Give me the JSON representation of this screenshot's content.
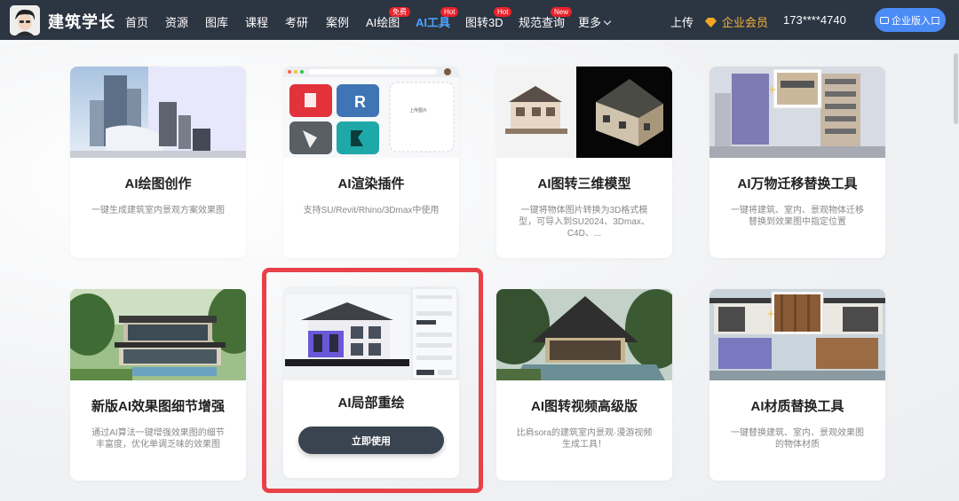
{
  "brand": "建筑学长",
  "nav": {
    "items": [
      {
        "label": "首页"
      },
      {
        "label": "资源"
      },
      {
        "label": "图库"
      },
      {
        "label": "课程"
      },
      {
        "label": "考研"
      },
      {
        "label": "案例"
      },
      {
        "label": "AI绘图",
        "badge": "免费"
      },
      {
        "label": "AI工具",
        "badge": "Hot",
        "active": true
      },
      {
        "label": "图转3D",
        "badge": "Hot"
      },
      {
        "label": "规范查询",
        "badge": "New"
      },
      {
        "label": "更多"
      }
    ],
    "upload": "上传",
    "vip": "企业会员",
    "phone": "173****4740",
    "enterprise": "企业版入口"
  },
  "colors": {
    "accent": "#4da3ff",
    "highlight": "#e8414a",
    "badge": "#e8222b",
    "topbar": "#2c3542"
  },
  "cards": [
    {
      "title": "AI绘图创作",
      "desc": "一键生成建筑室内景观方案效果图"
    },
    {
      "title": "AI渲染插件",
      "desc": "支持SU/Revit/Rhino/3Dmax中使用",
      "thumb_text": "上传图片"
    },
    {
      "title": "AI图转三维模型",
      "desc": "一键将物体图片转换为3D格式模型，可导入到SU2024、3Dmax、C4D、..."
    },
    {
      "title": "AI万物迁移替换工具",
      "desc": "一键将建筑、室内、景观物体迁移替换到效果图中指定位置"
    },
    {
      "title": "新版AI效果图细节增强",
      "desc": "通过AI算法一键增强效果图的细节丰富度，优化单调乏味的效果图"
    },
    {
      "title": "AI局部重绘",
      "button": "立即使用"
    },
    {
      "title": "AI图转视频高级版",
      "desc": "比肩sora的建筑室内景观·漫游视频生成工具！"
    },
    {
      "title": "AI材质替换工具",
      "desc": "一键替换建筑、室内、景观效果图的物体材质"
    }
  ]
}
